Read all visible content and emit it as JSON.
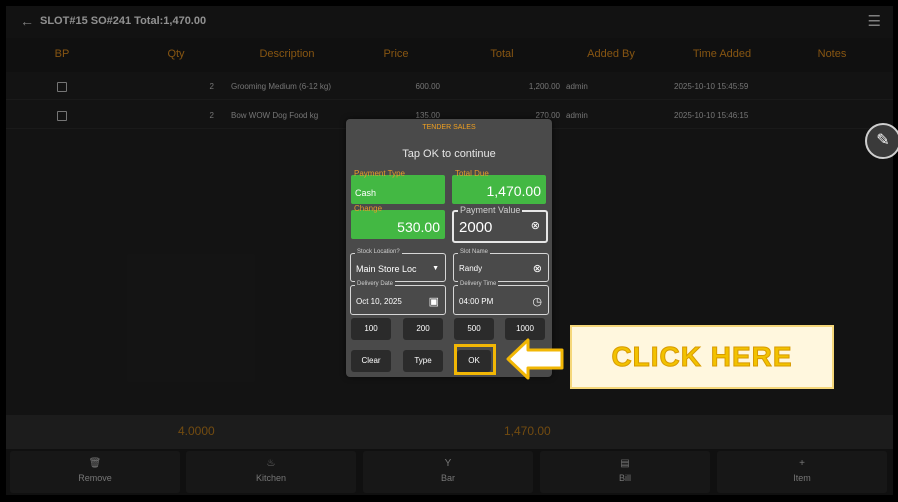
{
  "header": {
    "title": "SLOT#15 SO#241 Total:1,470.00"
  },
  "table": {
    "columns": [
      "BP",
      "Qty",
      "Description",
      "Price",
      "Total",
      "Added By",
      "Time Added",
      "Notes"
    ],
    "rows": [
      {
        "qty": "2",
        "description": "Grooming Medium (6-12 kg)",
        "price": "600.00",
        "total": "1,200.00",
        "added_by": "admin",
        "time_added": "2025-10-10 15:45:59"
      },
      {
        "qty": "2",
        "description": "Bow WOW Dog Food kg",
        "price": "135.00",
        "total": "270.00",
        "added_by": "admin",
        "time_added": "2025-10-10 15:46:15"
      }
    ]
  },
  "totals": {
    "qty": "4.0000",
    "total": "1,470.00"
  },
  "footer": {
    "remove": "Remove",
    "kitchen": "Kitchen",
    "bar": "Bar",
    "bill": "Bill",
    "item": "Item"
  },
  "dialog": {
    "title": "TENDER SALES",
    "subtitle": "Tap OK to continue",
    "payment_type_label": "Payment Type",
    "payment_type": "Cash",
    "total_due_label": "Total Due",
    "total_due": "1,470.00",
    "change_label": "Change",
    "change": "530.00",
    "payment_value_label": "Payment Value",
    "payment_value": "2000",
    "stock_location_label": "Stock Location?",
    "stock_location": "Main Store Loc",
    "slot_name_label": "Slot Name",
    "slot_name": "Randy",
    "delivery_date_label": "Delivery Date",
    "delivery_date": "Oct 10, 2025",
    "delivery_time_label": "Delivery Time",
    "delivery_time": "04:00 PM",
    "quick_amounts": [
      "100",
      "200",
      "500",
      "1000"
    ],
    "clear": "Clear",
    "type": "Type",
    "ok": "OK"
  },
  "callout": {
    "text": "CLICK HERE"
  },
  "colors": {
    "accent": "#d98a1d",
    "green": "#43b843",
    "highlight": "#f2b705"
  }
}
